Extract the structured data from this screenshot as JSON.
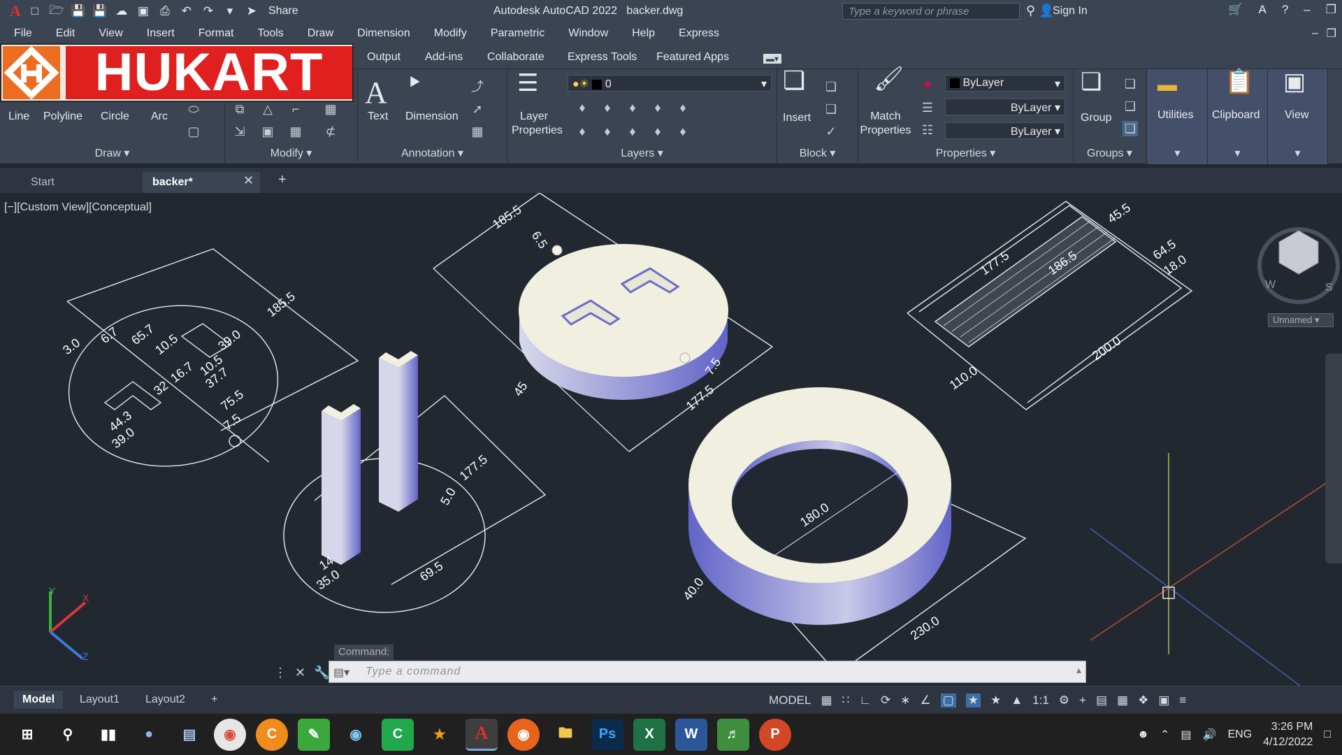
{
  "title": {
    "app": "Autodesk AutoCAD 2022",
    "file": "backer.dwg"
  },
  "qat": {
    "share": "Share"
  },
  "search": {
    "placeholder": "Type a keyword or phrase"
  },
  "account": {
    "signin": "Sign In"
  },
  "menu": [
    "File",
    "Edit",
    "View",
    "Insert",
    "Format",
    "Tools",
    "Draw",
    "Dimension",
    "Modify",
    "Parametric",
    "Window",
    "Help",
    "Express"
  ],
  "ribbon_tabs": [
    "Output",
    "Add-ins",
    "Collaborate",
    "Express Tools",
    "Featured Apps"
  ],
  "logo": {
    "text": "HUKART"
  },
  "draw": {
    "line": "Line",
    "polyline": "Polyline",
    "circle": "Circle",
    "arc": "Arc",
    "title": "Draw"
  },
  "modify": {
    "title": "Modify"
  },
  "annotation": {
    "text": "Text",
    "dimension": "Dimension",
    "title": "Annotation"
  },
  "layers": {
    "props": "Layer",
    "props2": "Properties",
    "current": "0",
    "title": "Layers"
  },
  "block": {
    "insert": "Insert",
    "title": "Block"
  },
  "properties": {
    "match1": "Match",
    "match2": "Properties",
    "color": "ByLayer",
    "linetype": "ByLayer",
    "lineweight": "ByLayer",
    "title": "Properties"
  },
  "groups": {
    "group": "Group",
    "title": "Groups"
  },
  "utilities": {
    "label": "Utilities"
  },
  "clipboard": {
    "label": "Clipboard"
  },
  "view": {
    "label": "View"
  },
  "doc_tabs": {
    "start": "Start",
    "active": "backer*"
  },
  "viewport": {
    "label": "[−][Custom View][Conceptual]",
    "viewcube_name": "Unnamed",
    "compass_w": "W",
    "compass_s": "S"
  },
  "dims": {
    "d1": "185.5",
    "d2": "3.0",
    "d3": "6.7",
    "d4": "65.7",
    "d5": "10.5",
    "d6": "39.0",
    "d7": "32",
    "d8": "16.7",
    "d9": "10.5",
    "d10": "37.7",
    "d11": "44.3",
    "d12": "75.5",
    "d13": "7.5",
    "d14": "39.0",
    "d15": "185.5",
    "d16": "6.5",
    "d17": "45",
    "d18": "7.5",
    "d19": "177.5",
    "d20": "177.5",
    "d21": "186.5",
    "d22": "45.5",
    "d23": "64.5",
    "d24": "18.0",
    "d25": "200.0",
    "d26": "110.0",
    "d27": "177.5",
    "d28": "5.0",
    "d29": "69.5",
    "d30": "35.0",
    "d31": "14",
    "d32": "180.0",
    "d33": "230.0",
    "d34": "40.0"
  },
  "command": {
    "label": "Command:",
    "placeholder": "Type  a  command"
  },
  "layouts": [
    "Model",
    "Layout1",
    "Layout2"
  ],
  "status": {
    "model": "MODEL",
    "scale": "1:1"
  },
  "tray": {
    "lang": "ENG",
    "time": "3:26 PM",
    "date": "4/12/2022"
  }
}
